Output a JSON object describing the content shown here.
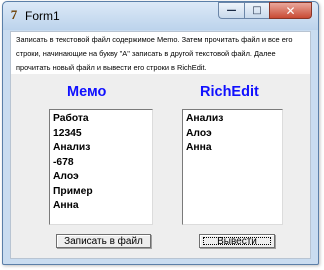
{
  "window": {
    "title": "Form1",
    "icon": "delphi-app-icon",
    "app_icon_glyph": "7",
    "minimize_glyph": "—",
    "maximize_glyph": "□",
    "close_glyph": "✕"
  },
  "instructions": {
    "line1": "Записать в текстовой файл содержимое Memo. Затем прочитать файл и все его",
    "line2": "строки, начинающие на букву \"А\" записать в другой текстовой файл. Далее",
    "line3": "прочитать новый файл и вывести его строки в RichEdit."
  },
  "memo": {
    "label": "Мемо",
    "lines": [
      "Работа",
      "12345",
      "Анализ",
      "-678",
      "Алоэ",
      "Пример",
      "Анна"
    ]
  },
  "richedit": {
    "label": "RichEdit",
    "lines": [
      "Анализ",
      "Алоэ",
      "Анна"
    ]
  },
  "buttons": {
    "save_label": "Записать в файл",
    "show_label": "Вывести"
  },
  "colors": {
    "label_blue": "#1010ff",
    "close_red": "#c94a34"
  }
}
